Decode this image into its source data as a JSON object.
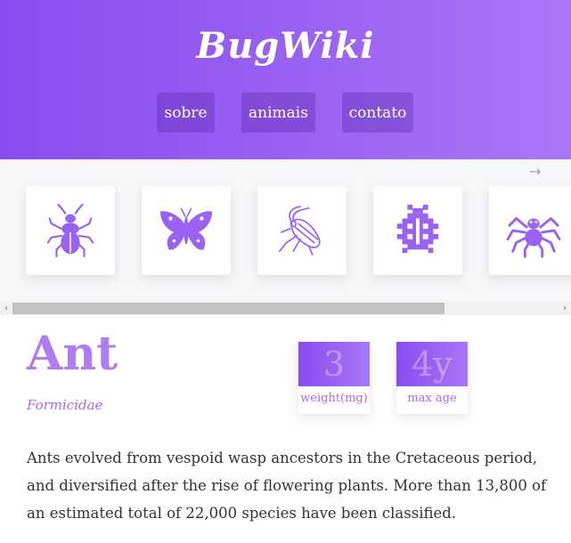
{
  "header": {
    "brand": "BugWiki",
    "nav": [
      "sobre",
      "animais",
      "contato"
    ]
  },
  "carousel": {
    "scroll_hint": "→",
    "cards": [
      {
        "icon": "beetle-icon"
      },
      {
        "icon": "butterfly-icon"
      },
      {
        "icon": "cricket-icon"
      },
      {
        "icon": "ladybug-icon"
      },
      {
        "icon": "spider-icon"
      }
    ]
  },
  "scrollbar": {
    "left": "‹",
    "right": "›"
  },
  "animal": {
    "name": "Ant",
    "latin": "Formicidae",
    "stats": [
      {
        "value": "3",
        "label": "weight(mg)"
      },
      {
        "value": "4y",
        "label": "max age"
      }
    ],
    "description": "Ants evolved from vespoid wasp ancestors in the Cretaceous period, and diversified after the rise of flowering plants. More than 13,800 of an estimated total of 22,000 species have been classified."
  },
  "colors": {
    "accent": "#9a62f2",
    "accent_text": "#a86bef",
    "title": "#b07cf6"
  }
}
